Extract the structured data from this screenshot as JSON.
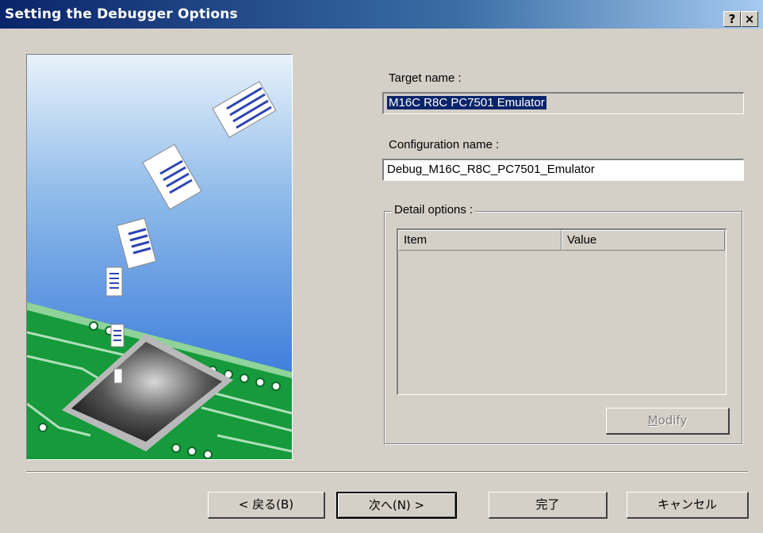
{
  "window": {
    "title": "Setting the Debugger Options",
    "help_label": "?",
    "close_label": "×"
  },
  "target": {
    "label": "Target name :",
    "value": "M16C R8C PC7501 Emulator"
  },
  "configuration": {
    "label": "Configuration name :",
    "value": "Debug_M16C_R8C_PC7501_Emulator"
  },
  "detail_options": {
    "legend": "Detail options :",
    "columns": [
      "Item",
      "Value"
    ],
    "rows": [],
    "modify_label_prefix": "",
    "modify_label_mnemonic": "M",
    "modify_label_rest": "odify"
  },
  "buttons": {
    "back": "< 戻る(B)",
    "next": "次へ(N) >",
    "finish": "完了",
    "cancel": "キャンセル"
  },
  "colors": {
    "title_bar_start": "#0a246a",
    "selection": "#0a246a",
    "dialog_face": "#d4d0c8",
    "board_green": "#169a3c",
    "sky_blue": "#3d7ddb"
  }
}
